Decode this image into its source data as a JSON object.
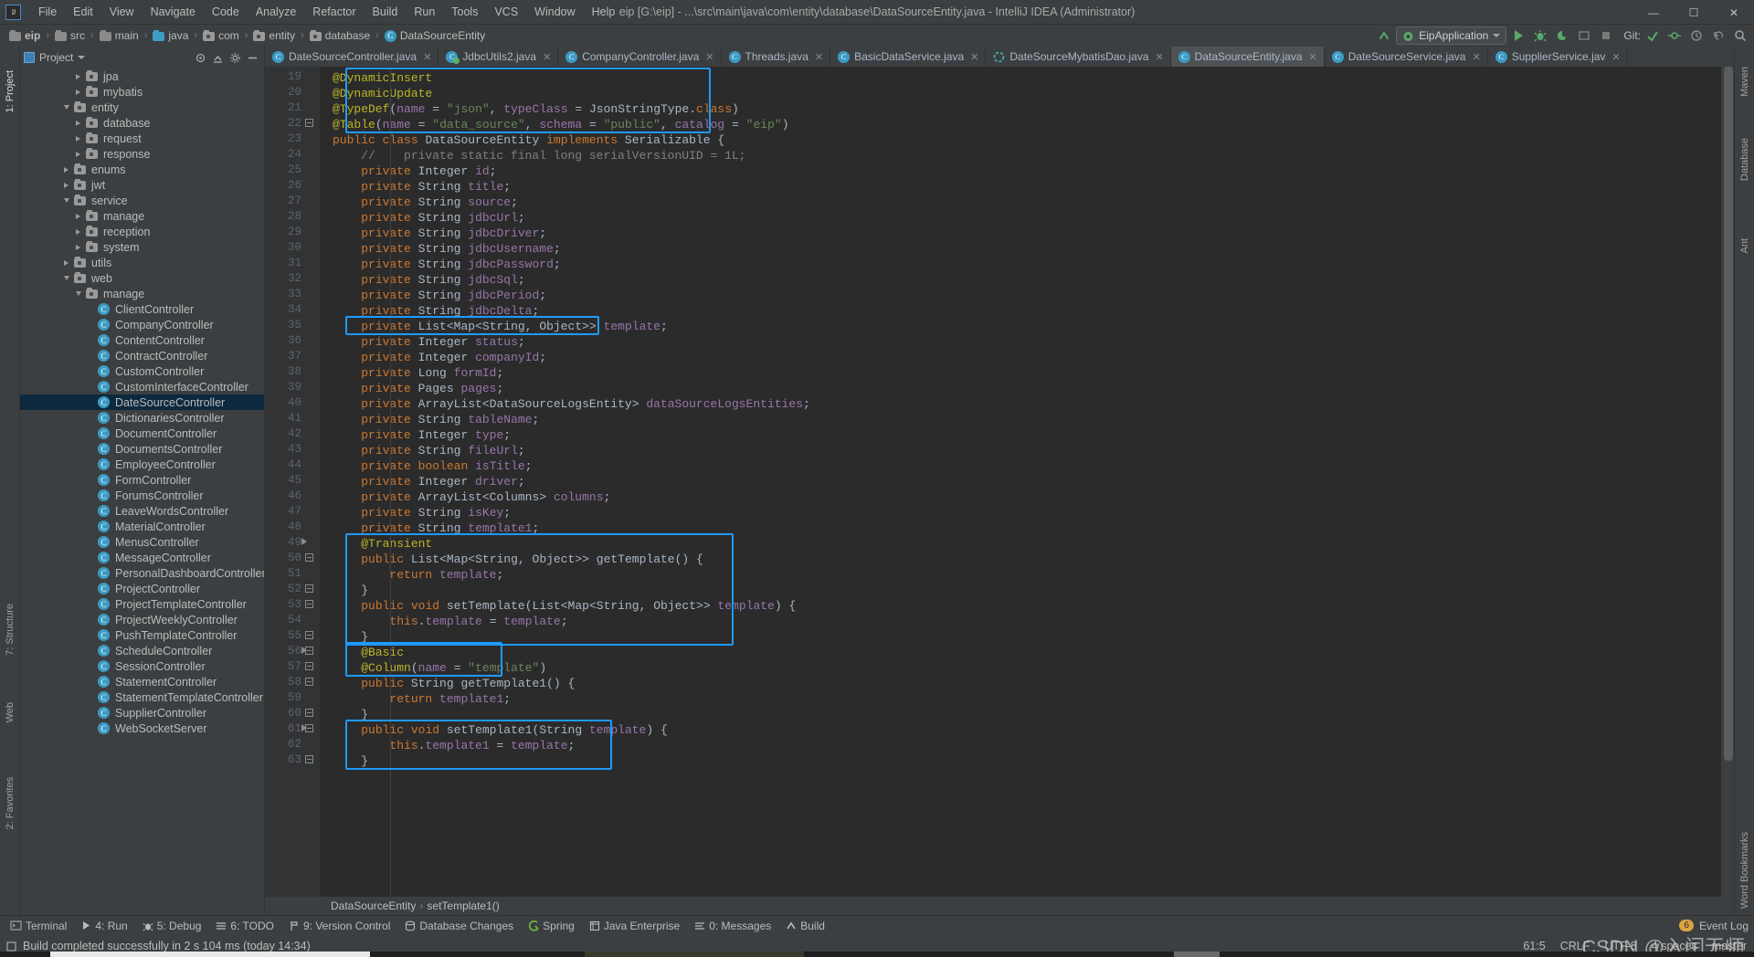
{
  "window": {
    "title": "eip [G:\\eip] - ...\\src\\main\\java\\com\\entity\\database\\DataSourceEntity.java - IntelliJ IDEA (Administrator)",
    "logo": "IJ",
    "minimize": "—",
    "maximize": "☐",
    "close": "✕"
  },
  "menu": [
    {
      "label": "File"
    },
    {
      "label": "Edit"
    },
    {
      "label": "View"
    },
    {
      "label": "Navigate"
    },
    {
      "label": "Code"
    },
    {
      "label": "Analyze"
    },
    {
      "label": "Refactor"
    },
    {
      "label": "Build"
    },
    {
      "label": "Run"
    },
    {
      "label": "Tools"
    },
    {
      "label": "VCS"
    },
    {
      "label": "Window"
    },
    {
      "label": "Help"
    }
  ],
  "breadcrumb": [
    {
      "label": "eip",
      "icon": "project-folder-icon"
    },
    {
      "label": "src",
      "icon": "folder-icon"
    },
    {
      "label": "main",
      "icon": "folder-icon"
    },
    {
      "label": "java",
      "icon": "source-folder-icon"
    },
    {
      "label": "com",
      "icon": "package-icon"
    },
    {
      "label": "entity",
      "icon": "package-icon"
    },
    {
      "label": "database",
      "icon": "package-icon"
    },
    {
      "label": "DataSourceEntity",
      "icon": "class-icon"
    }
  ],
  "toolbar": {
    "run_config": "EipApplication",
    "git_label": "Git:",
    "buttons": [
      "build-icon",
      "run-button",
      "debug-button",
      "coverage-button",
      "profiler-button",
      "stop-button",
      "search-everywhere-icon"
    ]
  },
  "project_panel": {
    "title": "Project",
    "actions": [
      "locate-icon",
      "collapse-all-icon",
      "settings-icon",
      "hide-icon"
    ],
    "tree": [
      {
        "label": "jpa",
        "indent": 5,
        "arrow": "right",
        "icon": "package",
        "selected": false
      },
      {
        "label": "mybatis",
        "indent": 5,
        "arrow": "right",
        "icon": "package",
        "selected": false
      },
      {
        "label": "entity",
        "indent": 4,
        "arrow": "down",
        "icon": "package",
        "selected": false
      },
      {
        "label": "database",
        "indent": 5,
        "arrow": "right",
        "icon": "package",
        "selected": false
      },
      {
        "label": "request",
        "indent": 5,
        "arrow": "right",
        "icon": "package",
        "selected": false
      },
      {
        "label": "response",
        "indent": 5,
        "arrow": "right",
        "icon": "package",
        "selected": false
      },
      {
        "label": "enums",
        "indent": 4,
        "arrow": "right",
        "icon": "package",
        "selected": false
      },
      {
        "label": "jwt",
        "indent": 4,
        "arrow": "right",
        "icon": "package",
        "selected": false
      },
      {
        "label": "service",
        "indent": 4,
        "arrow": "down",
        "icon": "package",
        "selected": false
      },
      {
        "label": "manage",
        "indent": 5,
        "arrow": "right",
        "icon": "package",
        "selected": false
      },
      {
        "label": "reception",
        "indent": 5,
        "arrow": "right",
        "icon": "package",
        "selected": false
      },
      {
        "label": "system",
        "indent": 5,
        "arrow": "right",
        "icon": "package",
        "selected": false
      },
      {
        "label": "utils",
        "indent": 4,
        "arrow": "right",
        "icon": "package",
        "selected": false
      },
      {
        "label": "web",
        "indent": 4,
        "arrow": "down",
        "icon": "package",
        "selected": false
      },
      {
        "label": "manage",
        "indent": 5,
        "arrow": "down",
        "icon": "package",
        "selected": false
      },
      {
        "label": "ClientController",
        "indent": 6,
        "arrow": "none",
        "icon": "class",
        "selected": false
      },
      {
        "label": "CompanyController",
        "indent": 6,
        "arrow": "none",
        "icon": "class",
        "selected": false
      },
      {
        "label": "ContentController",
        "indent": 6,
        "arrow": "none",
        "icon": "class",
        "selected": false
      },
      {
        "label": "ContractController",
        "indent": 6,
        "arrow": "none",
        "icon": "class",
        "selected": false
      },
      {
        "label": "CustomController",
        "indent": 6,
        "arrow": "none",
        "icon": "class",
        "selected": false
      },
      {
        "label": "CustomInterfaceController",
        "indent": 6,
        "arrow": "none",
        "icon": "class",
        "selected": false
      },
      {
        "label": "DateSourceController",
        "indent": 6,
        "arrow": "none",
        "icon": "class",
        "selected": true
      },
      {
        "label": "DictionariesController",
        "indent": 6,
        "arrow": "none",
        "icon": "class",
        "selected": false
      },
      {
        "label": "DocumentController",
        "indent": 6,
        "arrow": "none",
        "icon": "class",
        "selected": false
      },
      {
        "label": "DocumentsController",
        "indent": 6,
        "arrow": "none",
        "icon": "class",
        "selected": false
      },
      {
        "label": "EmployeeController",
        "indent": 6,
        "arrow": "none",
        "icon": "class",
        "selected": false
      },
      {
        "label": "FormController",
        "indent": 6,
        "arrow": "none",
        "icon": "class",
        "selected": false
      },
      {
        "label": "ForumsController",
        "indent": 6,
        "arrow": "none",
        "icon": "class",
        "selected": false
      },
      {
        "label": "LeaveWordsController",
        "indent": 6,
        "arrow": "none",
        "icon": "class",
        "selected": false
      },
      {
        "label": "MaterialController",
        "indent": 6,
        "arrow": "none",
        "icon": "class",
        "selected": false
      },
      {
        "label": "MenusController",
        "indent": 6,
        "arrow": "none",
        "icon": "class",
        "selected": false
      },
      {
        "label": "MessageController",
        "indent": 6,
        "arrow": "none",
        "icon": "class",
        "selected": false
      },
      {
        "label": "PersonalDashboardController",
        "indent": 6,
        "arrow": "none",
        "icon": "class",
        "selected": false
      },
      {
        "label": "ProjectController",
        "indent": 6,
        "arrow": "none",
        "icon": "class",
        "selected": false
      },
      {
        "label": "ProjectTemplateController",
        "indent": 6,
        "arrow": "none",
        "icon": "class",
        "selected": false
      },
      {
        "label": "ProjectWeeklyController",
        "indent": 6,
        "arrow": "none",
        "icon": "class",
        "selected": false
      },
      {
        "label": "PushTemplateController",
        "indent": 6,
        "arrow": "none",
        "icon": "class",
        "selected": false
      },
      {
        "label": "ScheduleController",
        "indent": 6,
        "arrow": "none",
        "icon": "class",
        "selected": false
      },
      {
        "label": "SessionController",
        "indent": 6,
        "arrow": "none",
        "icon": "class",
        "selected": false
      },
      {
        "label": "StatementController",
        "indent": 6,
        "arrow": "none",
        "icon": "class",
        "selected": false
      },
      {
        "label": "StatementTemplateController",
        "indent": 6,
        "arrow": "none",
        "icon": "class",
        "selected": false
      },
      {
        "label": "SupplierController",
        "indent": 6,
        "arrow": "none",
        "icon": "class",
        "selected": false
      },
      {
        "label": "WebSocketServer",
        "indent": 6,
        "arrow": "none",
        "icon": "class",
        "selected": false
      }
    ]
  },
  "left_rail": [
    {
      "label": "1: Project",
      "active": true
    },
    {
      "label": "7: Structure",
      "active": false
    },
    {
      "label": "Web",
      "active": false
    },
    {
      "label": "2: Favorites",
      "active": false
    }
  ],
  "right_rail": [
    {
      "label": "Database",
      "active": false
    },
    {
      "label": "Ant",
      "active": false
    },
    {
      "label": "Maven",
      "active": false
    },
    {
      "label": "Word Bookmarks",
      "active": false
    }
  ],
  "editor_tabs": [
    {
      "label": "DateSourceController.java",
      "icon": "class-icon",
      "active": false
    },
    {
      "label": "JdbcUtils2.java",
      "icon": "class-run-icon",
      "active": false
    },
    {
      "label": "CompanyController.java",
      "icon": "class-icon",
      "active": false
    },
    {
      "label": "Threads.java",
      "icon": "class-icon",
      "active": false
    },
    {
      "label": "BasicDataService.java",
      "icon": "class-icon",
      "active": false
    },
    {
      "label": "DateSourceMybatisDao.java",
      "icon": "interface-icon",
      "active": false
    },
    {
      "label": "DataSourceEntity.java",
      "icon": "class-icon",
      "active": true
    },
    {
      "label": "DateSourceService.java",
      "icon": "class-icon",
      "active": false
    },
    {
      "label": "SupplierService.jav",
      "icon": "class-icon",
      "active": false
    }
  ],
  "code": {
    "first_line_number": 19,
    "lines": [
      {
        "n": 19,
        "text": "@DynamicInsert"
      },
      {
        "n": 20,
        "text": "@DynamicUpdate"
      },
      {
        "n": 21,
        "text": "@TypeDef(name = \"json\", typeClass = JsonStringType.class)"
      },
      {
        "n": 22,
        "text": "@Table(name = \"data_source\", schema = \"public\", catalog = \"eip\")"
      },
      {
        "n": 23,
        "text": "public class DataSourceEntity implements Serializable {"
      },
      {
        "n": 24,
        "text": "    //    private static final long serialVersionUID = 1L;"
      },
      {
        "n": 25,
        "text": "    private Integer id;"
      },
      {
        "n": 26,
        "text": "    private String title;"
      },
      {
        "n": 27,
        "text": "    private String source;"
      },
      {
        "n": 28,
        "text": "    private String jdbcUrl;"
      },
      {
        "n": 29,
        "text": "    private String jdbcDriver;"
      },
      {
        "n": 30,
        "text": "    private String jdbcUsername;"
      },
      {
        "n": 31,
        "text": "    private String jdbcPassword;"
      },
      {
        "n": 32,
        "text": "    private String jdbcSql;"
      },
      {
        "n": 33,
        "text": "    private String jdbcPeriod;"
      },
      {
        "n": 34,
        "text": "    private String jdbcDelta;"
      },
      {
        "n": 35,
        "text": "    private List<Map<String, Object>> template;"
      },
      {
        "n": 36,
        "text": "    private Integer status;"
      },
      {
        "n": 37,
        "text": "    private Integer companyId;"
      },
      {
        "n": 38,
        "text": "    private Long formId;"
      },
      {
        "n": 39,
        "text": "    private Pages pages;"
      },
      {
        "n": 40,
        "text": "    private ArrayList<DataSourceLogsEntity> dataSourceLogsEntities;"
      },
      {
        "n": 41,
        "text": "    private String tableName;"
      },
      {
        "n": 42,
        "text": "    private Integer type;"
      },
      {
        "n": 43,
        "text": "    private String fileUrl;"
      },
      {
        "n": 44,
        "text": "    private boolean isTitle;"
      },
      {
        "n": 45,
        "text": "    private Integer driver;"
      },
      {
        "n": 46,
        "text": "    private ArrayList<Columns> columns;"
      },
      {
        "n": 47,
        "text": "    private String isKey;"
      },
      {
        "n": 48,
        "text": "    private String template1;"
      },
      {
        "n": 49,
        "text": "    @Transient"
      },
      {
        "n": 50,
        "text": "    public List<Map<String, Object>> getTemplate() {"
      },
      {
        "n": 51,
        "text": "        return template;"
      },
      {
        "n": 52,
        "text": "    }"
      },
      {
        "n": 53,
        "text": "    public void setTemplate(List<Map<String, Object>> template) {"
      },
      {
        "n": 54,
        "text": "        this.template = template;"
      },
      {
        "n": 55,
        "text": "    }"
      },
      {
        "n": 56,
        "text": "    @Basic"
      },
      {
        "n": 57,
        "text": "    @Column(name = \"template\")"
      },
      {
        "n": 58,
        "text": "    public String getTemplate1() {"
      },
      {
        "n": 59,
        "text": "        return template1;"
      },
      {
        "n": 60,
        "text": "    }"
      },
      {
        "n": 61,
        "text": "    public void setTemplate1(String template) {"
      },
      {
        "n": 62,
        "text": "        this.template1 = template;"
      },
      {
        "n": 63,
        "text": "    }"
      }
    ],
    "highlight_color": "#1e9afe",
    "highlights": [
      {
        "name": "annotations-block",
        "from_line": 19,
        "to_line": 22
      },
      {
        "name": "template-field",
        "from_line": 35,
        "to_line": 35
      },
      {
        "name": "template-accessors",
        "from_line": 49,
        "to_line": 55
      },
      {
        "name": "basic-column-block",
        "from_line": 56,
        "to_line": 57
      },
      {
        "name": "set-template1-block",
        "from_line": 61,
        "to_line": 63
      }
    ]
  },
  "editor_breadcrumb": [
    {
      "label": "DataSourceEntity"
    },
    {
      "label": "setTemplate1()"
    }
  ],
  "bottom_toolbar": [
    {
      "label": "Terminal",
      "mnemonic": "",
      "icon": "terminal-icon"
    },
    {
      "label": "4: Run",
      "mnemonic": "4",
      "icon": "run-icon"
    },
    {
      "label": "5: Debug",
      "mnemonic": "5",
      "icon": "debug-icon"
    },
    {
      "label": "6: TODO",
      "mnemonic": "6",
      "icon": "todo-icon"
    },
    {
      "label": "9: Version Control",
      "mnemonic": "9",
      "icon": "vcs-icon"
    },
    {
      "label": "Database Changes",
      "mnemonic": "",
      "icon": "database-icon"
    },
    {
      "label": "Spring",
      "mnemonic": "",
      "icon": "spring-icon"
    },
    {
      "label": "Java Enterprise",
      "mnemonic": "",
      "icon": "java-ee-icon"
    },
    {
      "label": "0: Messages",
      "mnemonic": "0",
      "icon": "messages-icon"
    },
    {
      "label": "Build",
      "mnemonic": "",
      "icon": "build-icon"
    }
  ],
  "event_log": {
    "label": "Event Log",
    "count": "6"
  },
  "statusbar": {
    "message": "Build completed successfully in 2 s 104 ms (today 14:34)",
    "caret": "61:5",
    "line_separator": "CRLF",
    "encoding": "UTF-8",
    "indent": "4 spaces",
    "branch": "master",
    "watermark": "CSDN @入闰无师"
  }
}
